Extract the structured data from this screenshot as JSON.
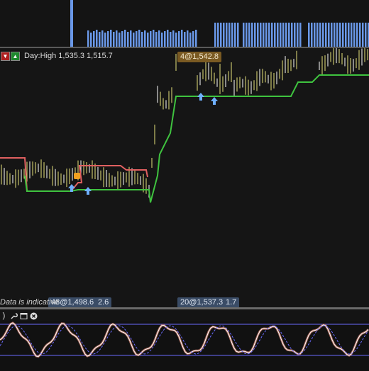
{
  "header": {
    "day_label": "Day:High 1,535.3  1,515.7",
    "sell_button_icon": "down-arrow-icon",
    "buy_button_icon": "up-arrow-icon"
  },
  "price_tags": {
    "top_tag": "4@1,542.8",
    "bottom_left_tag": "48@1,498.6",
    "bottom_left_tail": "2.6",
    "bottom_right_tag": "20@1,537.3",
    "bottom_right_tail": "1.7"
  },
  "notice": {
    "text": "Data is indicative"
  },
  "osc_toolbar": {
    "icons": [
      "paren-icon",
      "wrench-icon",
      "window-icon",
      "close-icon"
    ],
    "paren_glyph": ")"
  },
  "colors": {
    "up_bar": "#e8e37a",
    "down_bar": "#ffffff",
    "stop_green": "#3fc33f",
    "stop_red": "#e06060",
    "volume": "#6a98e8",
    "marker_arrow": "#6fb0ff",
    "osc_blue": "#6b6bff",
    "osc_white": "#ffffff",
    "osc_fill": "#c87a6a"
  }
}
